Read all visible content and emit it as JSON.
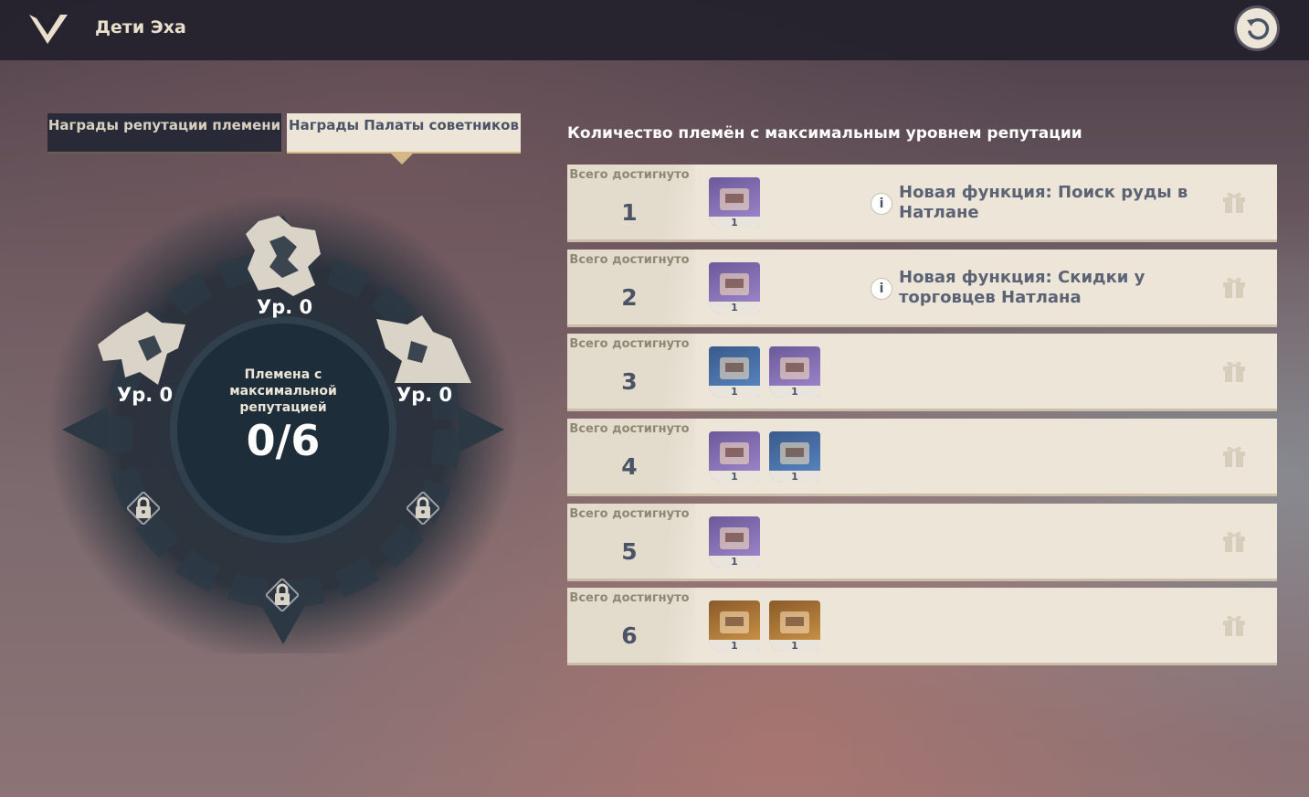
{
  "header": {
    "title": "Дети Эха"
  },
  "tabs": [
    {
      "label": "Награды репутации племени",
      "active": false
    },
    {
      "label": "Награды Палаты советников",
      "active": true
    }
  ],
  "emblem": {
    "levels": [
      "Ур. 0",
      "Ур. 0",
      "Ур. 0"
    ],
    "center_label": "Племена с максимальной репутацией",
    "center_count": "0/6"
  },
  "rewards": {
    "title": "Количество племён с максимальным уровнем репутации",
    "rows": [
      {
        "label": "Всего достигнуто",
        "num": "1",
        "items": [
          {
            "qty": "1",
            "icon": "bulletin-board-icon"
          }
        ],
        "info": "Новая функция: Поиск руды в Натлане"
      },
      {
        "label": "Всего достигнуто",
        "num": "2",
        "items": [
          {
            "qty": "1",
            "icon": "gadget-ring-icon"
          }
        ],
        "info": "Новая функция: Скидки у торговцев Натлана"
      },
      {
        "label": "Всего достигнуто",
        "num": "3",
        "items": [
          {
            "qty": "1",
            "icon": "namecard-icon"
          },
          {
            "qty": "1",
            "icon": "hero-wit-icon"
          }
        ],
        "info": ""
      },
      {
        "label": "Всего достигнуто",
        "num": "4",
        "items": [
          {
            "qty": "1",
            "icon": "bulletin-board-icon"
          },
          {
            "qty": "1",
            "icon": "blueprint-icon"
          }
        ],
        "info": ""
      },
      {
        "label": "Всего достигнуто",
        "num": "5",
        "items": [
          {
            "qty": "1",
            "icon": "weapon-icon"
          }
        ],
        "info": ""
      },
      {
        "label": "Всего достигнуто",
        "num": "6",
        "items": [
          {
            "qty": "1",
            "icon": "gift-box-blue-icon"
          },
          {
            "qty": "1",
            "icon": "gift-box-red-icon"
          }
        ],
        "info": ""
      }
    ]
  },
  "colors": {
    "topbar": "#23212d",
    "row_bg": "#ece5d8",
    "text_dark": "#4b5366",
    "accent_gold": "#d4b887"
  }
}
